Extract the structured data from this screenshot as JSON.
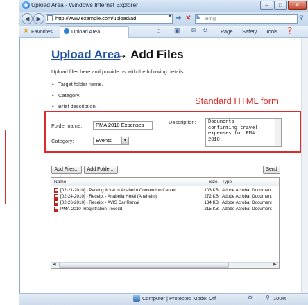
{
  "window": {
    "title": "Upload Area - Windows Internet Explorer",
    "address": "http://www.example.com/upload/ad",
    "search_placeholder": "Bing"
  },
  "favorites_bar": {
    "favorites_label": "Favorites",
    "tab_label": "Upload Area"
  },
  "command_bar": {
    "page": "Page",
    "safety": "Safety",
    "tools": "Tools"
  },
  "page": {
    "title_link": "Upload Area",
    "title_rest": "→ Add Files",
    "intro": "Upload files here and provide us with the following details:",
    "bullets": [
      "Target folder name.",
      "Category.",
      "Brief description."
    ],
    "annotation": "Standard HTML form"
  },
  "form": {
    "folder_label": "Folder name:",
    "folder_value": "PMA 2010 Expenses",
    "category_label": "Category:",
    "category_value": "Events",
    "description_label": "Description:",
    "description_value": "Documents\nconfirming travel\nexpenses for PMA\n2010."
  },
  "uploader": {
    "add_files": "Add Files...",
    "add_folder": "Add Folder...",
    "send": "Send",
    "columns": {
      "name": "Name",
      "size": "Size",
      "type": "Type"
    },
    "files": [
      {
        "name": "[02-21-2010] - Parking ticket in Anaheim Convention Center",
        "size": "103 KB",
        "type": "Adobe Acrobat Document"
      },
      {
        "name": "[02-24-2010] - Receipt - Anabella Hotel (Anaheim)",
        "size": "272 KB",
        "type": "Adobe Acrobat Document"
      },
      {
        "name": "[02-26-2010] - Receipt - AVIS Car Rental",
        "size": "134 KB",
        "type": "Adobe Acrobat Document"
      },
      {
        "name": "PMA-2010_Registration_receipt",
        "size": "215 KB",
        "type": "Adobe Acrobat Document"
      }
    ]
  },
  "status_bar": {
    "zone": "Computer | Protected Mode: Off",
    "zoom": "100%"
  },
  "colors": {
    "annotation_red": "#e22a2a",
    "link_blue": "#1f4fa3"
  }
}
